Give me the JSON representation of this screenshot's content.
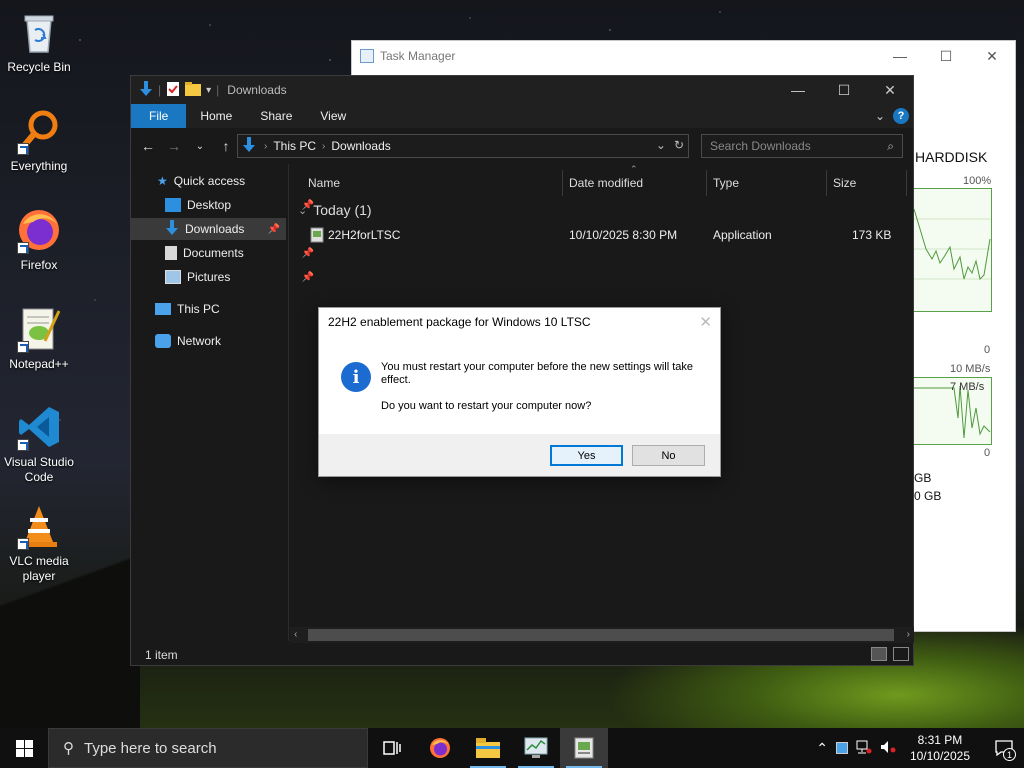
{
  "desktop": {
    "icons": [
      {
        "label": "Recycle Bin"
      },
      {
        "label": "Everything"
      },
      {
        "label": "Firefox"
      },
      {
        "label": "Notepad++"
      },
      {
        "label": "Visual Studio Code"
      },
      {
        "label": "VLC media player"
      }
    ]
  },
  "task_manager": {
    "title": "Task Manager",
    "disk_label": "HARDDISK",
    "pct_top": "100%",
    "zero_1": "0",
    "speed_scale": "10 MB/s",
    "speed_current": "7 MB/s",
    "zero_2": "0",
    "gb_1": "GB",
    "gb_2": "0 GB"
  },
  "explorer": {
    "title": "Downloads",
    "ribbon": {
      "file": "File",
      "home": "Home",
      "share": "Share",
      "view": "View"
    },
    "address": {
      "root": "This PC",
      "folder": "Downloads"
    },
    "search_placeholder": "Search Downloads",
    "nav": {
      "quick_access": "Quick access",
      "desktop": "Desktop",
      "downloads": "Downloads",
      "documents": "Documents",
      "pictures": "Pictures",
      "this_pc": "This PC",
      "network": "Network"
    },
    "columns": {
      "name": "Name",
      "date": "Date modified",
      "type": "Type",
      "size": "Size"
    },
    "group_label": "Today (1)",
    "files": [
      {
        "name": "22H2forLTSC",
        "date": "10/10/2025 8:30 PM",
        "type": "Application",
        "size": "173 KB"
      }
    ],
    "status": "1 item"
  },
  "dialog": {
    "title": "22H2 enablement package for Windows 10 LTSC",
    "message": "You must restart your computer before the new settings will take effect.",
    "question": "Do you want to restart your computer now?",
    "yes": "Yes",
    "no": "No"
  },
  "taskbar": {
    "search_placeholder": "Type here to search",
    "time": "8:31 PM",
    "date": "10/10/2025",
    "notification_count": "1"
  },
  "colors": {
    "accent": "#1a78c2",
    "info_icon": "#1c6bd1",
    "graph_line": "#5aa04a"
  }
}
